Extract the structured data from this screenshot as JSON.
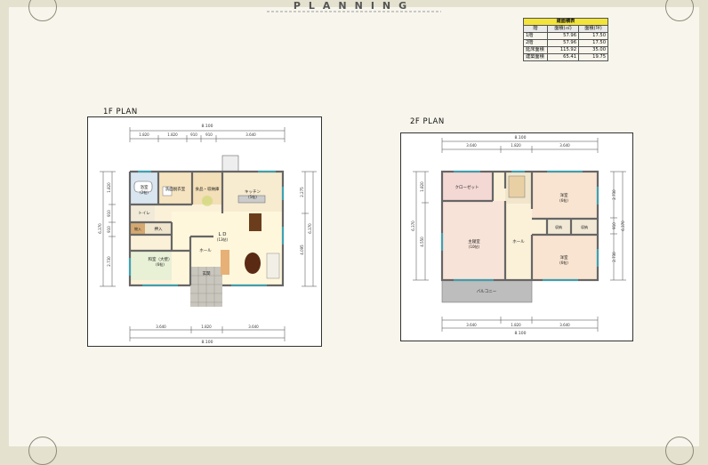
{
  "title": "PLANNING",
  "area_table": {
    "header": "建面積表",
    "columns": [
      "階",
      "面積(㎡)",
      "面積(坪)"
    ],
    "rows": [
      [
        "1階",
        "57.96",
        "17.50"
      ],
      [
        "2階",
        "57.96",
        "17.50"
      ],
      [
        "延床面積",
        "115.92",
        "35.00"
      ],
      [
        "建築面積",
        "65.41",
        "19.75"
      ]
    ]
  },
  "plan1": {
    "label": "1F PLAN",
    "dims_top": [
      "1.820",
      "1.820",
      "910",
      "910",
      "3.640"
    ],
    "total_top": "8.100",
    "dims_bottom": [
      "3.640",
      "1.820",
      "3.640"
    ],
    "total_bottom": "8.100",
    "dims_left": [
      "1.820",
      "910",
      "910",
      "2.730"
    ],
    "total_left": "6.370",
    "dims_right": [
      "2.275",
      "4.095"
    ],
    "total_right": "6.370",
    "rooms": {
      "bath": "浴室",
      "bath_size": "(2帖)",
      "washroom": "洗面脱衣室",
      "pantry": "食品・収納庫",
      "kitchen": "キッチン",
      "kitchen_size": "(5帖)",
      "toilet": "トイレ",
      "storage": "物入",
      "closet": "押入",
      "ld": "L D",
      "ld_size": "(13帖)",
      "hall": "ホール",
      "washitsu": "和室（大壁）",
      "washitsu_size": "(6帖)",
      "entrance": "玄関"
    }
  },
  "plan2": {
    "label": "2F PLAN",
    "dims_top": [
      "3.640",
      "1.820",
      "3.640"
    ],
    "total_top": "8.100",
    "dims_bottom": [
      "3.640",
      "1.820",
      "3.640"
    ],
    "total_bottom": "8.100",
    "dims_left": [
      "1.820",
      "4.550"
    ],
    "total_left": "6.370",
    "dims_right": [
      "2.730",
      "910",
      "2.730"
    ],
    "total_right": "6.370",
    "rooms": {
      "closet": "クローゼット",
      "bedroom1": "洋室",
      "bedroom1_size": "(6帖)",
      "master": "主寝室",
      "master_size": "(10帖)",
      "hall": "ホール",
      "wic1": "収納",
      "wic2": "収納",
      "bedroom2": "洋室",
      "bedroom2_size": "(6帖)",
      "balcony": "バルコニー"
    }
  }
}
